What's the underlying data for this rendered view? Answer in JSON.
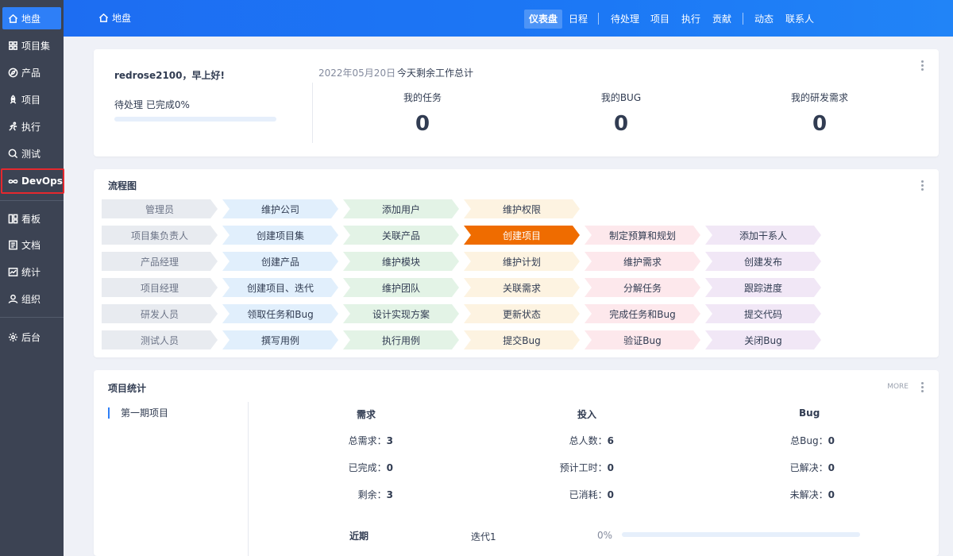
{
  "sidebar": {
    "items": [
      {
        "label": "地盘",
        "icon": "home-icon"
      },
      {
        "label": "项目集",
        "icon": "grid-icon"
      },
      {
        "label": "产品",
        "icon": "compass-icon"
      },
      {
        "label": "项目",
        "icon": "rocket-icon"
      },
      {
        "label": "执行",
        "icon": "run-icon"
      },
      {
        "label": "测试",
        "icon": "search-icon"
      },
      {
        "label": "DevOps",
        "icon": "infinity-icon"
      },
      {
        "label": "看板",
        "icon": "kanban-icon"
      },
      {
        "label": "文档",
        "icon": "doc-icon"
      },
      {
        "label": "统计",
        "icon": "chart-icon"
      },
      {
        "label": "组织",
        "icon": "user-icon"
      },
      {
        "label": "后台",
        "icon": "gear-icon"
      }
    ]
  },
  "topbar": {
    "breadcrumb": "地盘",
    "nav": [
      "仪表盘",
      "日程",
      "待处理",
      "项目",
      "执行",
      "贡献",
      "动态",
      "联系人"
    ]
  },
  "welcome": {
    "greeting": "redrose2100，早上好!",
    "progress_label": "待处理 已完成0%",
    "progress": 0,
    "date": "2022年05月20日",
    "summary": "今天剩余工作总计",
    "stats": [
      {
        "label": "我的任务",
        "value": "0"
      },
      {
        "label": "我的BUG",
        "value": "0"
      },
      {
        "label": "我的研发需求",
        "value": "0"
      }
    ]
  },
  "flow": {
    "title": "流程图",
    "rows": [
      [
        "管理员",
        "维护公司",
        "添加用户",
        "维护权限"
      ],
      [
        "项目集负责人",
        "创建项目集",
        "关联产品",
        "创建项目",
        "制定预算和规划",
        "添加干系人"
      ],
      [
        "产品经理",
        "创建产品",
        "维护模块",
        "维护计划",
        "维护需求",
        "创建发布"
      ],
      [
        "项目经理",
        "创建项目、迭代",
        "维护团队",
        "关联需求",
        "分解任务",
        "跟踪进度"
      ],
      [
        "研发人员",
        "领取任务和Bug",
        "设计实现方案",
        "更新状态",
        "完成任务和Bug",
        "提交代码"
      ],
      [
        "测试人员",
        "撰写用例",
        "执行用例",
        "提交Bug",
        "验证Bug",
        "关闭Bug"
      ]
    ],
    "highlight": "创建项目"
  },
  "project_stats": {
    "title": "项目统计",
    "more": "MORE",
    "project": "第一期项目",
    "columns": [
      {
        "head": "需求",
        "items": [
          {
            "k": "总需求：",
            "v": "3"
          },
          {
            "k": "已完成：",
            "v": "0"
          },
          {
            "k": "剩余：",
            "v": "3"
          }
        ]
      },
      {
        "head": "投入",
        "items": [
          {
            "k": "总人数：",
            "v": "6"
          },
          {
            "k": "预计工时：",
            "v": "0"
          },
          {
            "k": "已消耗：",
            "v": "0"
          }
        ]
      },
      {
        "head": "Bug",
        "items": [
          {
            "k": "总Bug：",
            "v": "0"
          },
          {
            "k": "已解决：",
            "v": "0"
          },
          {
            "k": "未解决：",
            "v": "0"
          }
        ]
      }
    ],
    "recent": {
      "label": "近期",
      "name": "迭代1",
      "pct": "0%",
      "progress": 0
    }
  },
  "colors": {
    "accent": "#2e7ff7",
    "highlight": "#ef6c00",
    "sidebar": "#3c4353",
    "devops_outline": "#e5282e"
  }
}
